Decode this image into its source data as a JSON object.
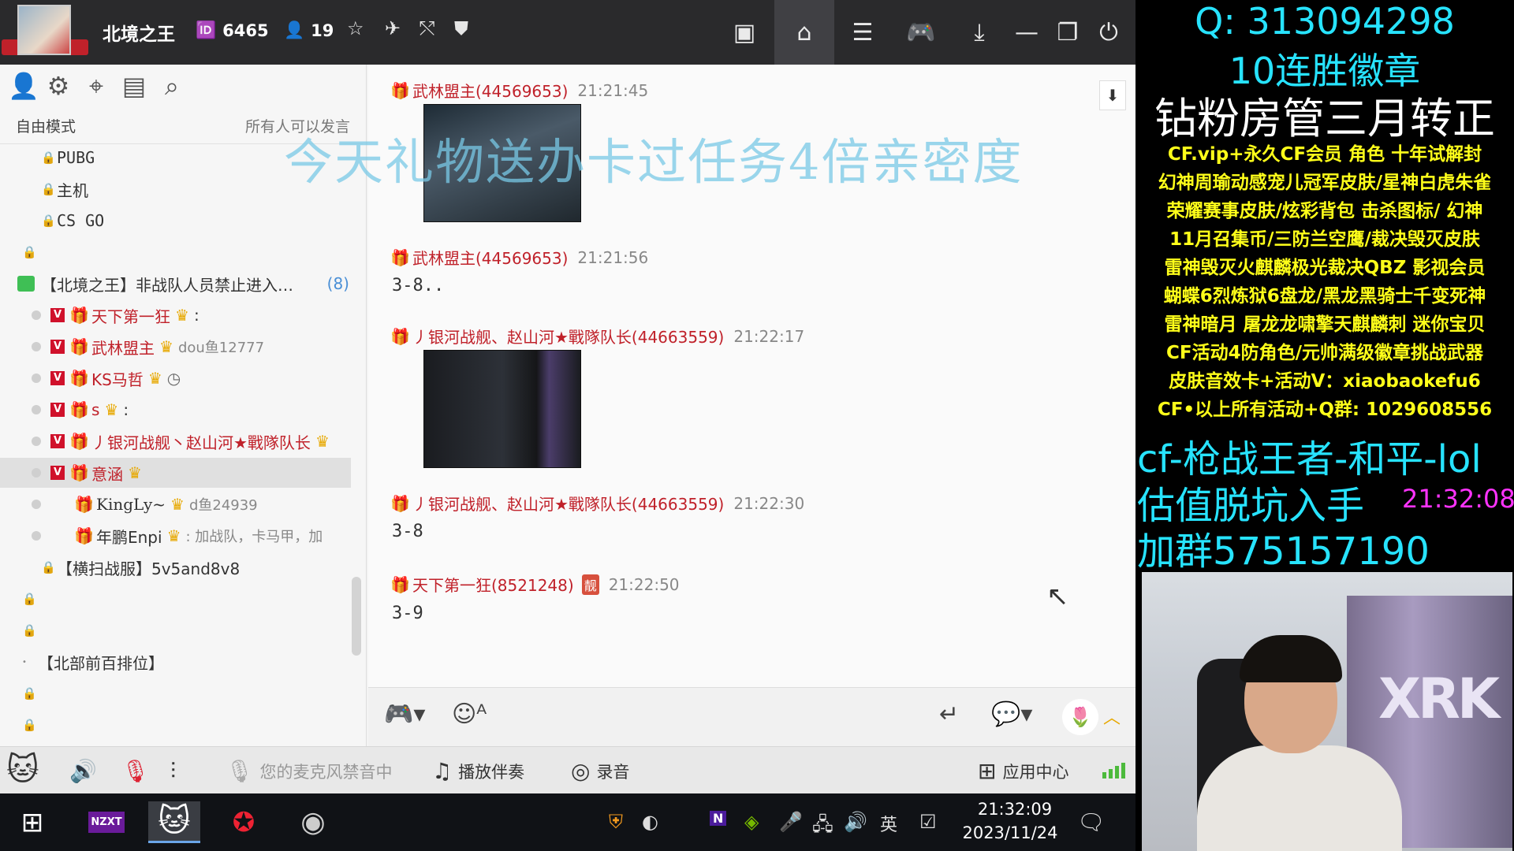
{
  "titlebar": {
    "room_name": "北境之王",
    "room_id": "6465",
    "online_count": "19",
    "id_icon": "id-card-icon",
    "user_icon": "person-icon"
  },
  "left_panel": {
    "mode": "自由模式",
    "speak_rule": "所有人可以发言",
    "tree": [
      {
        "label": "PUBG"
      },
      {
        "label": "主机"
      },
      {
        "label": "CS GO"
      },
      {
        "label": ""
      },
      {
        "label": "【北境之王】非战队人员禁止进入…",
        "count": "(8)"
      },
      {
        "name": "天下第一狂",
        "suffix": ":"
      },
      {
        "name": "武林盟主",
        "suffix": "dou鱼12777"
      },
      {
        "name": "KS马哲",
        "suffix": ""
      },
      {
        "name": "s",
        "suffix": ":"
      },
      {
        "name": "丿银河战舰丶赵山河★戰隊队长",
        "suffix": ""
      },
      {
        "name": "意涵",
        "suffix": ""
      },
      {
        "name": "KingLy~",
        "suffix": "d鱼24939"
      },
      {
        "name": "年鹏Enpi",
        "suffix": ": 加战队，卡马甲，加"
      },
      {
        "label": "【横扫战服】5v5and8v8"
      },
      {
        "label": ""
      },
      {
        "label": ""
      },
      {
        "label": "【北部前百排位】"
      },
      {
        "label": ""
      },
      {
        "label": ""
      }
    ]
  },
  "chat": {
    "overlay_title": "今天礼物送办卡过任务4倍亲密度",
    "messages": [
      {
        "user": "武林盟主(44569653)",
        "time": "21:21:45",
        "body": ""
      },
      {
        "user": "武林盟主(44569653)",
        "time": "21:21:56",
        "body": "3-8.."
      },
      {
        "user": "丿银河战舰、赵山河★戰隊队长(44663559)",
        "time": "21:22:17",
        "body": ""
      },
      {
        "user": "丿银河战舰、赵山河★戰隊队长(44663559)",
        "time": "21:22:30",
        "body": "3-8"
      },
      {
        "user": "天下第一狂(8521248)",
        "time": "21:22:50",
        "body": "3-9",
        "badge": "靓"
      }
    ]
  },
  "bottom_bar": {
    "mic_status": "您的麦克风禁音中",
    "play_music": "播放伴奏",
    "record": "录音",
    "app_center": "应用中心"
  },
  "taskbar": {
    "ime": "英",
    "time": "21:32:09",
    "date": "2023/11/24",
    "nzxt": "NZXT"
  },
  "overlay": {
    "qq": "Q:   313094298",
    "badge_line": "10连胜徽章",
    "admin_line": "钻粉房管三月转正",
    "promo_lines": [
      "CF.vip+永久CF会员 角色 十年试解封",
      "幻神周瑜动感宠儿冠军皮肤/星神白虎朱雀",
      "荣耀赛事皮肤/炫彩背包 击杀图标/ 幻神",
      "11月召集币/三防兰空鹰/裁决毁灭皮肤",
      "雷神毁灭火麒麟极光裁决QBZ 影视会员",
      "蝴蝶6烈炼狱6盘龙/黑龙黑骑士千变死神",
      "雷神暗月 屠龙龙啸擎天麒麟刺 迷你宝贝",
      "CF活动4防角色/元帅满级徽章挑战武器",
      "皮肤音效卡+活动V：xiaobaokefu6",
      "CF•以上所有活动+Q群: 1029608556"
    ],
    "cf_line": "cf-枪战王者-和平-lol",
    "estimate_line": "估值脱坑入手",
    "clock": "21:32:08",
    "group_line": "加群575157190",
    "webcam_logo": "XRK"
  }
}
